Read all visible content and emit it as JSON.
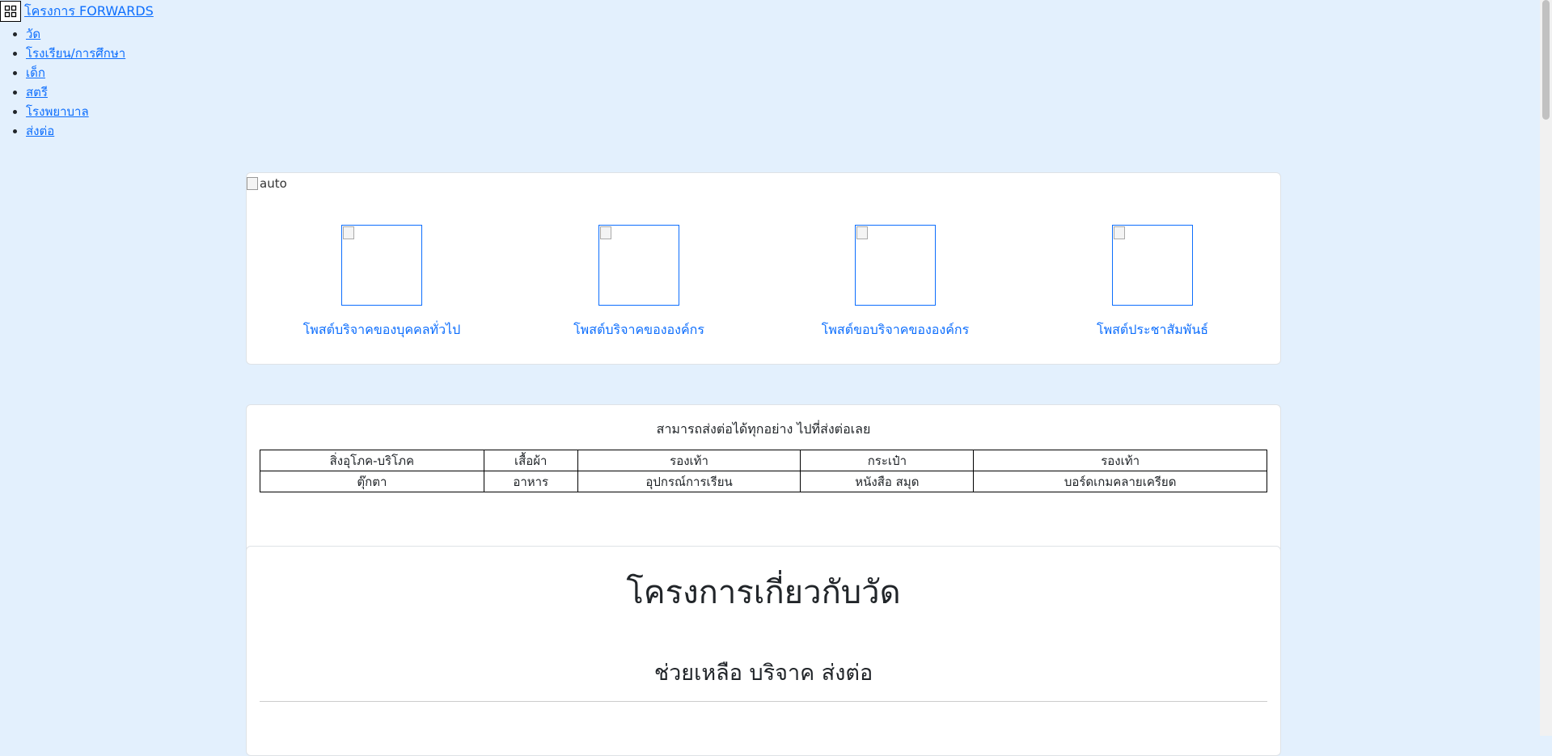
{
  "header": {
    "brand": "โครงการ FORWARDS"
  },
  "nav": {
    "items": [
      {
        "label": "วัด"
      },
      {
        "label": "โรงเรียน/การศึกษา"
      },
      {
        "label": "เด็ก"
      },
      {
        "label": "สตรี"
      },
      {
        "label": "โรงพยาบาล"
      },
      {
        "label": "ส่งต่อ"
      }
    ]
  },
  "hero": {
    "image_alt": "auto",
    "tiles": [
      {
        "label": "โพสต์บริจาคของบุคคลทั่วไป"
      },
      {
        "label": "โพสต์บริจาคขององค์กร"
      },
      {
        "label": "โพสต์ขอบริจาคขององค์กร"
      },
      {
        "label": "โพสต์ประชาสัมพันธ์"
      }
    ]
  },
  "forward": {
    "title": "สามารถส่งต่อได้ทุกอย่าง ไปที่ส่งต่อเลย",
    "rows": [
      [
        "สิ่งอุโภค-บริโภค",
        "เสื้อผ้า",
        "รองเท้า",
        "กระเป๋า",
        "รองเท้า"
      ],
      [
        "ตุ๊กตา",
        "อาหาร",
        "อุปกรณ์การเรียน",
        "หนังสือ สมุด",
        "บอร์ดเกมคลายเครียด"
      ]
    ]
  },
  "temple": {
    "heading": "โครงการเกี่ยวกับวัด",
    "subheading": "ช่วยเหลือ บริจาค ส่งต่อ"
  }
}
